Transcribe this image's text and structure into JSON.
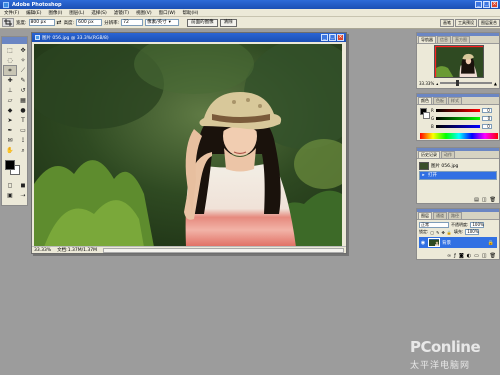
{
  "app": {
    "title": "Adobe Photoshop"
  },
  "menu": [
    "文件(F)",
    "编辑(E)",
    "图像(I)",
    "图层(L)",
    "选择(S)",
    "滤镜(T)",
    "视图(V)",
    "窗口(W)",
    "帮助(H)"
  ],
  "options": {
    "width_label": "宽度:",
    "width_value": "800 px",
    "height_label": "高度:",
    "height_value": "600 px",
    "resolution_label": "分辨率:",
    "resolution_value": "72",
    "resolution_unit": "像素/英寸",
    "front_image_button": "前面的图像",
    "clear_button": "清除"
  },
  "palette_well": [
    "画笔",
    "工具预设",
    "图层复合"
  ],
  "document": {
    "title": "图片 056.jpg @ 33.3%(RGB/8)",
    "zoom": "33.33%",
    "doc_info": "文档:1.37M/1.37M"
  },
  "navigator": {
    "tabs": [
      "导航器",
      "信息",
      "直方图"
    ],
    "zoom": "33.33%"
  },
  "color": {
    "tabs": [
      "颜色",
      "色板",
      "样式"
    ],
    "rows": [
      {
        "label": "R",
        "value": "0"
      },
      {
        "label": "G",
        "value": "0"
      },
      {
        "label": "B",
        "value": "0"
      }
    ]
  },
  "history": {
    "tabs": [
      "历史记录",
      "动作"
    ],
    "snapshot": "图片 056.jpg",
    "items": [
      "打开"
    ]
  },
  "layers": {
    "tabs": [
      "图层",
      "通道",
      "路径"
    ],
    "blend_mode": "正常",
    "opacity_label": "不透明度:",
    "opacity_value": "100%",
    "lock_label": "锁定:",
    "fill_label": "填充:",
    "fill_value": "100%",
    "background_layer": "背景"
  },
  "watermark": {
    "line1": "PConline",
    "line2": "太平洋电脑网"
  },
  "colors": {
    "selection": "#3170e3",
    "titlebar": "#1b4fb4"
  }
}
